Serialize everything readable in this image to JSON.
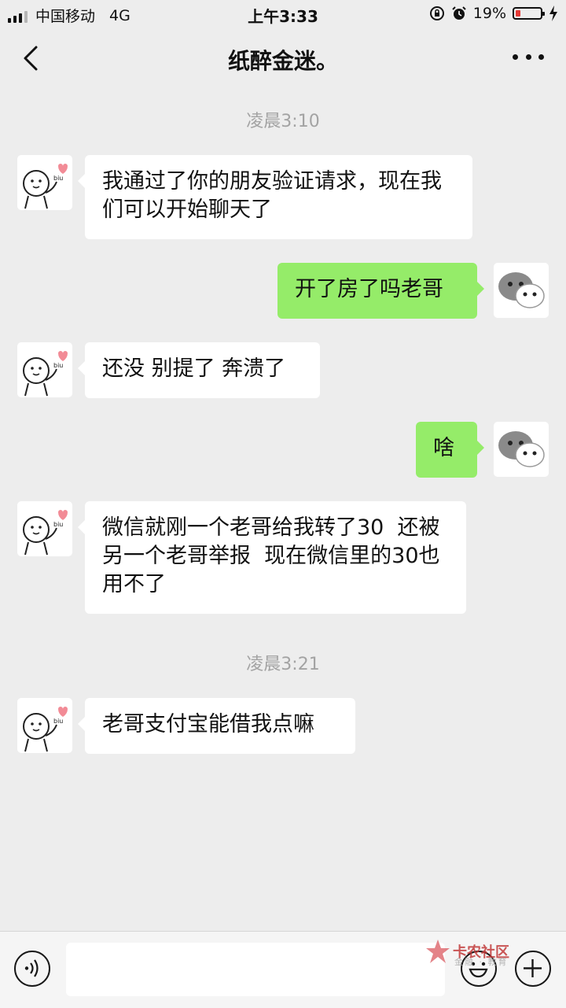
{
  "status_bar": {
    "carrier": "中国移动",
    "network": "4G",
    "time": "上午3:33",
    "battery_percent": "19%",
    "battery_level": 0.19
  },
  "nav": {
    "title": "纸醉金迷。"
  },
  "chat": {
    "timestamps": [
      "凌晨3:10",
      "凌晨3:21"
    ],
    "messages": [
      {
        "sender": "contact",
        "text": "我通过了你的朋友验证请求，现在我们可以开始聊天了"
      },
      {
        "sender": "me",
        "text": "开了房了吗老哥"
      },
      {
        "sender": "contact",
        "text": "还没 别提了 奔溃了"
      },
      {
        "sender": "me",
        "text": "啥"
      },
      {
        "sender": "contact",
        "text": "微信就刚一个老哥给我转了30  还被另一个老哥举报  现在微信里的30也用不了"
      },
      {
        "sender": "contact",
        "text": "老哥支付宝能借我点嘛"
      }
    ]
  },
  "input_bar": {
    "text_value": ""
  },
  "watermark": {
    "text": "卡农社区",
    "subtext": "金融 · 教育"
  },
  "colors": {
    "background": "#ededed",
    "outgoing_bubble": "#95ec69",
    "incoming_bubble": "#ffffff",
    "timestamp": "#a3a3a3",
    "battery_low": "#e53935"
  },
  "icons": {
    "back": "chevron-left-icon",
    "more": "more-dots-icon",
    "voice": "voice-icon",
    "emoji": "emoji-icon",
    "plus": "plus-icon",
    "alarm": "alarm-icon",
    "lock": "rotation-lock-icon",
    "charging": "charging-icon"
  }
}
